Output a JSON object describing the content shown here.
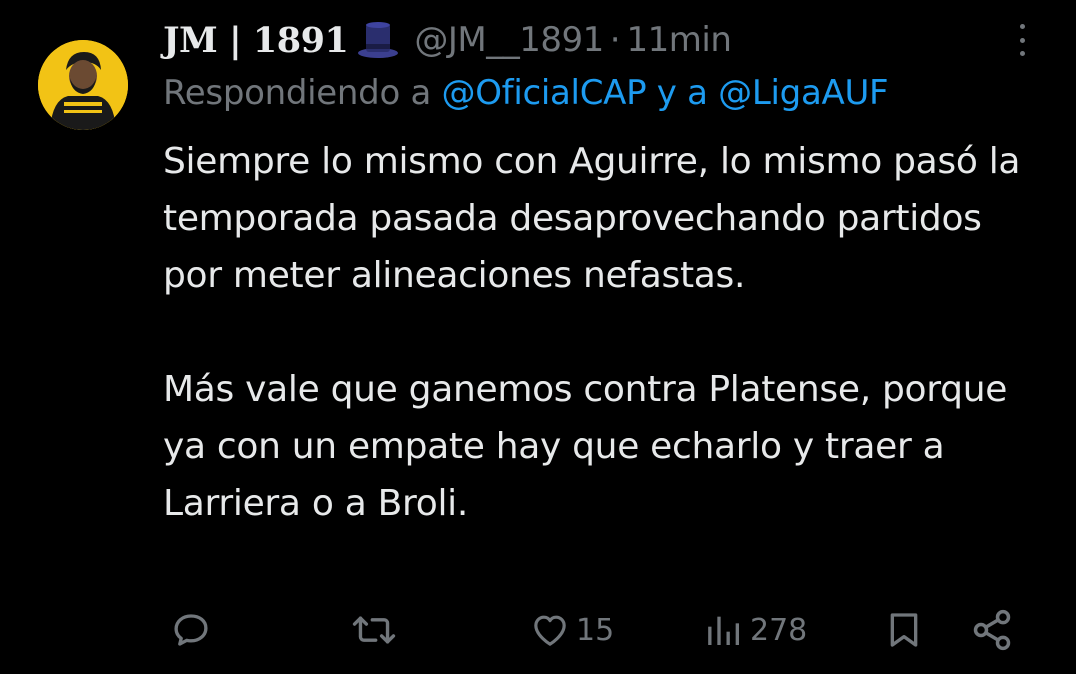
{
  "tweet": {
    "display_name": "JM | 1891",
    "badge_icon": "top-hat-icon",
    "handle": "@JM__1891",
    "separator": "·",
    "time": "11min",
    "reply_prefix": "Respondiendo a",
    "reply_mentions_text": "@OficialCAP y a @LigaAUF",
    "text_paragraphs": [
      "Siempre lo mismo con Aguirre, lo mismo pasó la temporada pasada desaprovechando partidos por meter alineaciones nefastas.",
      "Más vale que ganemos contra Platense, porque ya con un empate hay que echarlo y traer a Larriera o a Broli."
    ]
  },
  "actions": {
    "reply_icon": "speech-bubble-icon",
    "retweet_icon": "retweet-icon",
    "like_icon": "heart-icon",
    "like_count": "15",
    "views_icon": "bar-chart-icon",
    "views_count": "278",
    "bookmark_icon": "bookmark-icon",
    "share_icon": "share-icon"
  },
  "colors": {
    "background": "#000000",
    "text_primary": "#e7e9ea",
    "text_secondary": "#71767b",
    "accent": "#1d9bf0",
    "avatar_bg": "#f2c315"
  }
}
